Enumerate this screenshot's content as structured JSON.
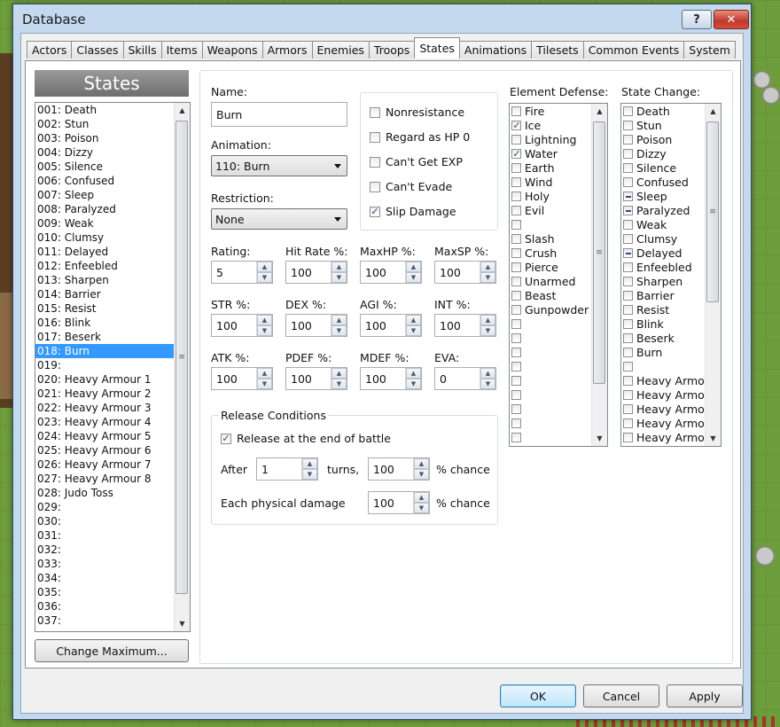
{
  "window": {
    "title": "Database",
    "help_glyph": "?",
    "close_glyph": "✕"
  },
  "tabs": [
    "Actors",
    "Classes",
    "Skills",
    "Items",
    "Weapons",
    "Armors",
    "Enemies",
    "Troops",
    "States",
    "Animations",
    "Tilesets",
    "Common Events",
    "System"
  ],
  "active_tab": "States",
  "states_panel": {
    "header": "States",
    "items": [
      "001: Death",
      "002: Stun",
      "003: Poison",
      "004: Dizzy",
      "005: Silence",
      "006: Confused",
      "007: Sleep",
      "008: Paralyzed",
      "009: Weak",
      "010: Clumsy",
      "011: Delayed",
      "012: Enfeebled",
      "013: Sharpen",
      "014: Barrier",
      "015: Resist",
      "016: Blink",
      "017: Beserk",
      "018: Burn",
      "019:",
      "020: Heavy Armour 1",
      "021: Heavy Armour 2",
      "022: Heavy Armour 3",
      "023: Heavy Armour 4",
      "024: Heavy Armour 5",
      "025: Heavy Armour 6",
      "026: Heavy Armour 7",
      "027: Heavy Armour 8",
      "028: Judo Toss",
      "029:",
      "030:",
      "031:",
      "032:",
      "033:",
      "034:",
      "035:",
      "036:",
      "037:"
    ],
    "selected_index": 17,
    "change_max_label": "Change Maximum..."
  },
  "form": {
    "name_label": "Name:",
    "name_value": "Burn",
    "animation_label": "Animation:",
    "animation_value": "110: Burn",
    "restriction_label": "Restriction:",
    "restriction_value": "None",
    "options": [
      {
        "label": "Nonresistance",
        "checked": false
      },
      {
        "label": "Regard as HP 0",
        "checked": false
      },
      {
        "label": "Can't Get EXP",
        "checked": false
      },
      {
        "label": "Can't Evade",
        "checked": false
      },
      {
        "label": "Slip Damage",
        "checked": true
      }
    ],
    "stats": [
      {
        "label": "Rating:",
        "value": "5"
      },
      {
        "label": "Hit Rate %:",
        "value": "100"
      },
      {
        "label": "MaxHP %:",
        "value": "100"
      },
      {
        "label": "MaxSP %:",
        "value": "100"
      },
      {
        "label": "STR %:",
        "value": "100"
      },
      {
        "label": "DEX %:",
        "value": "100"
      },
      {
        "label": "AGI %:",
        "value": "100"
      },
      {
        "label": "INT %:",
        "value": "100"
      },
      {
        "label": "ATK %:",
        "value": "100"
      },
      {
        "label": "PDEF %:",
        "value": "100"
      },
      {
        "label": "MDEF %:",
        "value": "100"
      },
      {
        "label": "EVA:",
        "value": "0"
      }
    ],
    "release": {
      "title": "Release Conditions",
      "end_of_battle_label": "Release at the end of battle",
      "end_of_battle_checked": true,
      "after_label": "After",
      "after_value": "1",
      "turns_label": "turns,",
      "turn_chance_value": "100",
      "chance_label": "% chance",
      "physical_label": "Each physical damage",
      "physical_chance_value": "100",
      "chance_label2": "% chance"
    }
  },
  "element_defense": {
    "label": "Element Defense:",
    "items": [
      {
        "label": "Fire",
        "state": "none"
      },
      {
        "label": "Ice",
        "state": "checked"
      },
      {
        "label": "Lightning",
        "state": "none"
      },
      {
        "label": "Water",
        "state": "checked"
      },
      {
        "label": "Earth",
        "state": "none"
      },
      {
        "label": "Wind",
        "state": "none"
      },
      {
        "label": "Holy",
        "state": "none"
      },
      {
        "label": "Evil",
        "state": "none"
      },
      {
        "label": "",
        "state": "none"
      },
      {
        "label": "Slash",
        "state": "none"
      },
      {
        "label": "Crush",
        "state": "none"
      },
      {
        "label": "Pierce",
        "state": "none"
      },
      {
        "label": "Unarmed",
        "state": "none"
      },
      {
        "label": "Beast",
        "state": "none"
      },
      {
        "label": "Gunpowder",
        "state": "none"
      },
      {
        "label": "",
        "state": "none"
      },
      {
        "label": "",
        "state": "none"
      },
      {
        "label": "",
        "state": "none"
      },
      {
        "label": "",
        "state": "none"
      },
      {
        "label": "",
        "state": "none"
      },
      {
        "label": "",
        "state": "none"
      },
      {
        "label": "",
        "state": "none"
      },
      {
        "label": "",
        "state": "none"
      },
      {
        "label": "",
        "state": "none"
      }
    ]
  },
  "state_change": {
    "label": "State Change:",
    "items": [
      {
        "label": "Death",
        "state": "none"
      },
      {
        "label": "Stun",
        "state": "none"
      },
      {
        "label": "Poison",
        "state": "none"
      },
      {
        "label": "Dizzy",
        "state": "none"
      },
      {
        "label": "Silence",
        "state": "none"
      },
      {
        "label": "Confused",
        "state": "none"
      },
      {
        "label": "Sleep",
        "state": "minus"
      },
      {
        "label": "Paralyzed",
        "state": "minus"
      },
      {
        "label": "Weak",
        "state": "none"
      },
      {
        "label": "Clumsy",
        "state": "none"
      },
      {
        "label": "Delayed",
        "state": "minus"
      },
      {
        "label": "Enfeebled",
        "state": "none"
      },
      {
        "label": "Sharpen",
        "state": "none"
      },
      {
        "label": "Barrier",
        "state": "none"
      },
      {
        "label": "Resist",
        "state": "none"
      },
      {
        "label": "Blink",
        "state": "none"
      },
      {
        "label": "Beserk",
        "state": "none"
      },
      {
        "label": "Burn",
        "state": "none"
      },
      {
        "label": "",
        "state": "none"
      },
      {
        "label": "Heavy Armour",
        "state": "none"
      },
      {
        "label": "Heavy Armour",
        "state": "none"
      },
      {
        "label": "Heavy Armour",
        "state": "none"
      },
      {
        "label": "Heavy Armour",
        "state": "none"
      },
      {
        "label": "Heavy Armour",
        "state": "none"
      }
    ]
  },
  "footer": {
    "ok": "OK",
    "cancel": "Cancel",
    "apply": "Apply"
  },
  "icons": {
    "scroll_up": "▲",
    "scroll_down": "▼",
    "grip": "≡"
  }
}
